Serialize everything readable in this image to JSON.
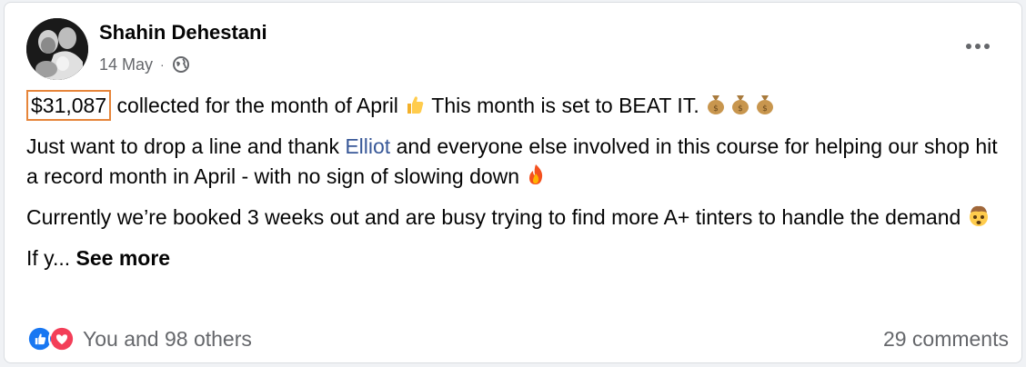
{
  "post": {
    "author": "Shahin Dehestani",
    "date": "14 May",
    "amount": "$31,087",
    "line1_rest": "collected for the month of April",
    "line1_tail": "This month is set to BEAT IT.",
    "p2_before": "Just want to drop a line and thank",
    "p2_link": "Elliot",
    "p2_after": "and everyone else involved in this course for helping our shop hit a record month in April - with no sign of slowing down",
    "p3": "Currently we’re booked 3 weeks out and are busy trying to find more A+ tinters to handle the demand",
    "truncated": "If y...",
    "see_more": "See more"
  },
  "footer": {
    "reactions_text": "You and 98 others",
    "comments_text": "29 comments"
  },
  "colors": {
    "highlight_border": "#e6853a",
    "link": "#385898",
    "like_blue": "#1877f2",
    "love_red": "#f33e58"
  },
  "icons": [
    "globe-icon",
    "more-options-icon",
    "thumbs-up-emoji",
    "money-bag-emoji",
    "fire-emoji",
    "exploding-head-emoji",
    "like-reaction-icon",
    "love-reaction-icon"
  ]
}
